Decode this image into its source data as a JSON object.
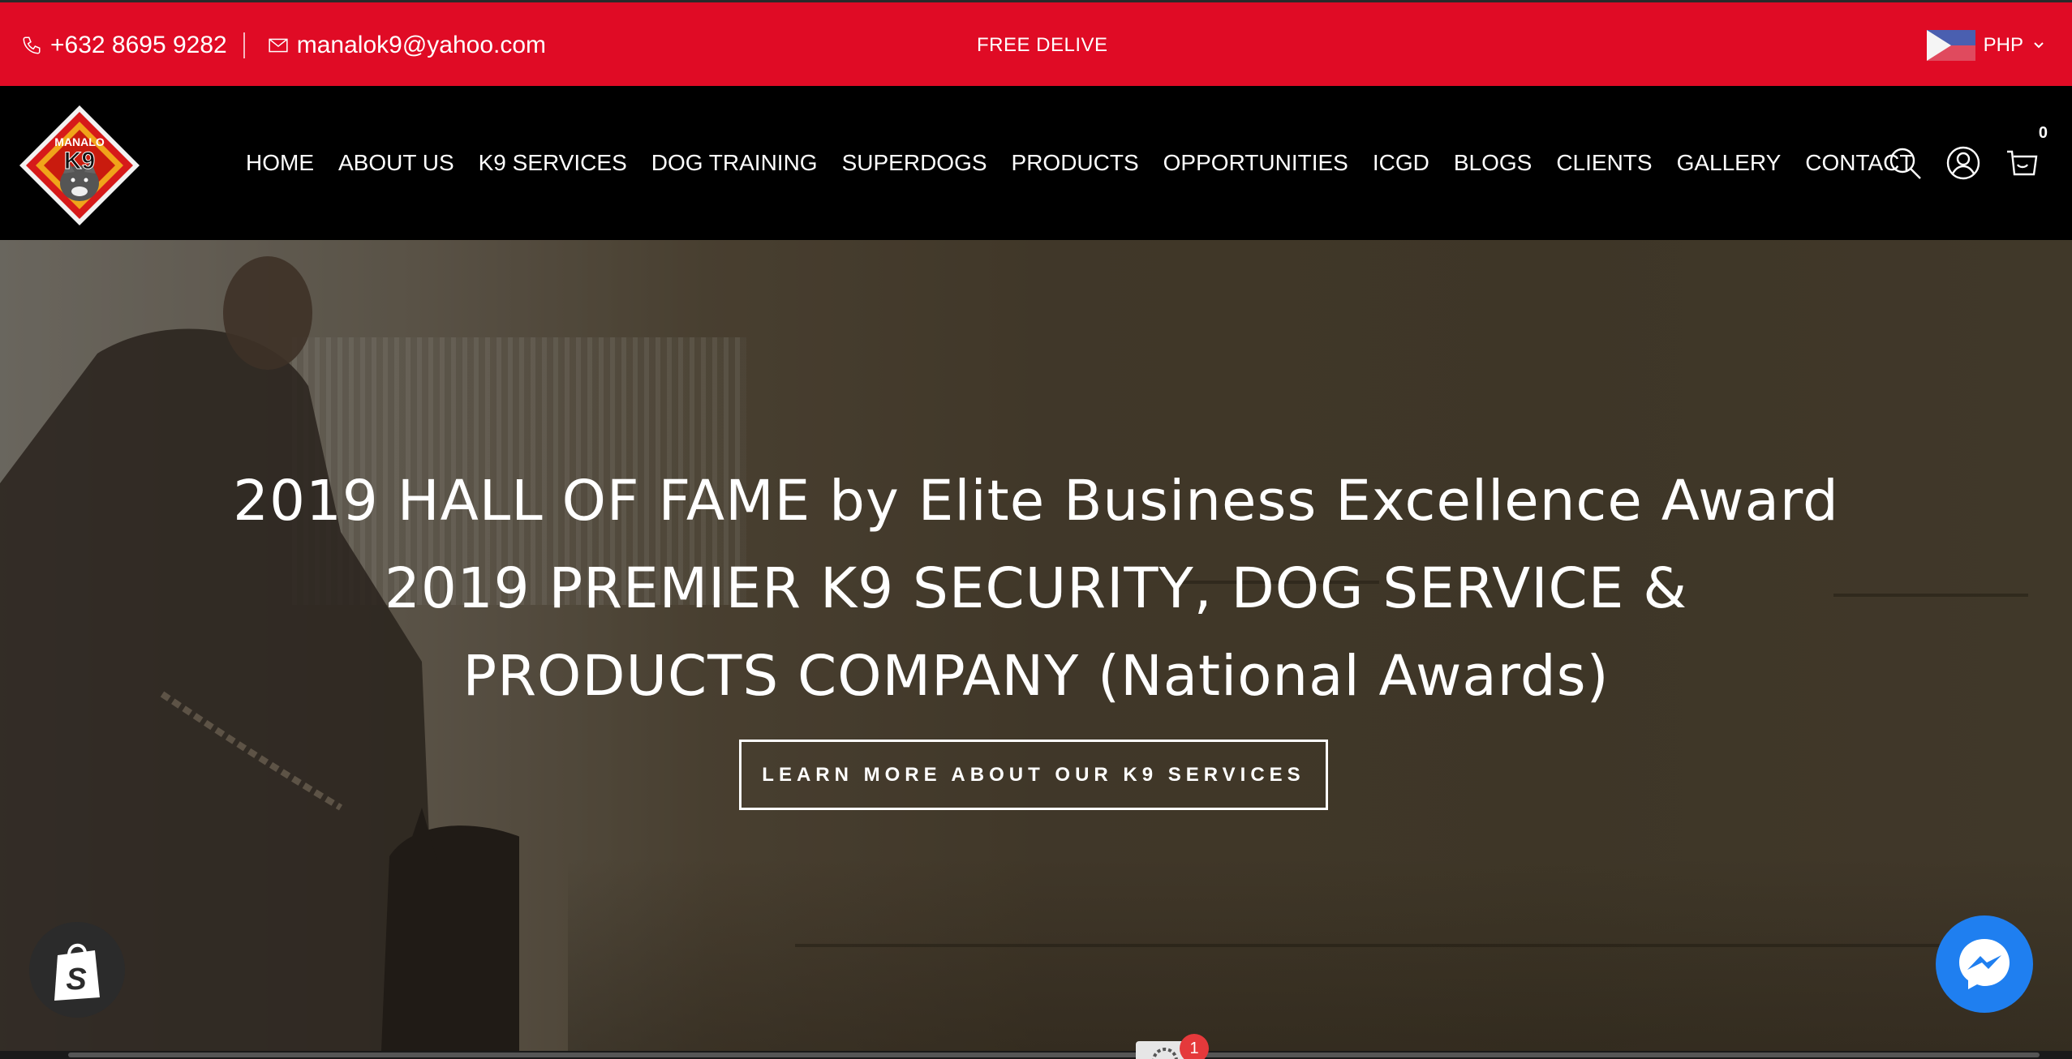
{
  "topbar": {
    "phone": "+632 8695 9282",
    "email": "manalok9@yahoo.com",
    "promo": "FREE DELIVE",
    "currency": "PHP",
    "colors": {
      "background": "#e00b25"
    }
  },
  "logo": {
    "line1": "MANALO",
    "line2": "K9"
  },
  "nav": {
    "items": [
      {
        "label": "HOME"
      },
      {
        "label": "ABOUT US"
      },
      {
        "label": "K9 SERVICES"
      },
      {
        "label": "DOG TRAINING"
      },
      {
        "label": "SUPERDOGS"
      },
      {
        "label": "PRODUCTS"
      },
      {
        "label": "OPPORTUNITIES"
      },
      {
        "label": "ICGD"
      },
      {
        "label": "BLOGS"
      },
      {
        "label": "CLIENTS"
      },
      {
        "label": "GALLERY"
      },
      {
        "label": "CONTACT"
      }
    ]
  },
  "header_icons": {
    "search": "search-icon",
    "account": "user-icon",
    "cart": "cart-icon",
    "cart_count": "0"
  },
  "hero": {
    "line1": "2019 HALL OF FAME by Elite Business Excellence Award",
    "line2": "2019 PREMIER K9 SECURITY, DOG SERVICE &",
    "line3": "PRODUCTS COMPANY (National Awards)",
    "cta_label": "LEARN MORE ABOUT OUR K9 SERVICES"
  },
  "widgets": {
    "shopify": "shopify-icon",
    "messenger": "messenger-icon",
    "notification_count": "1"
  }
}
